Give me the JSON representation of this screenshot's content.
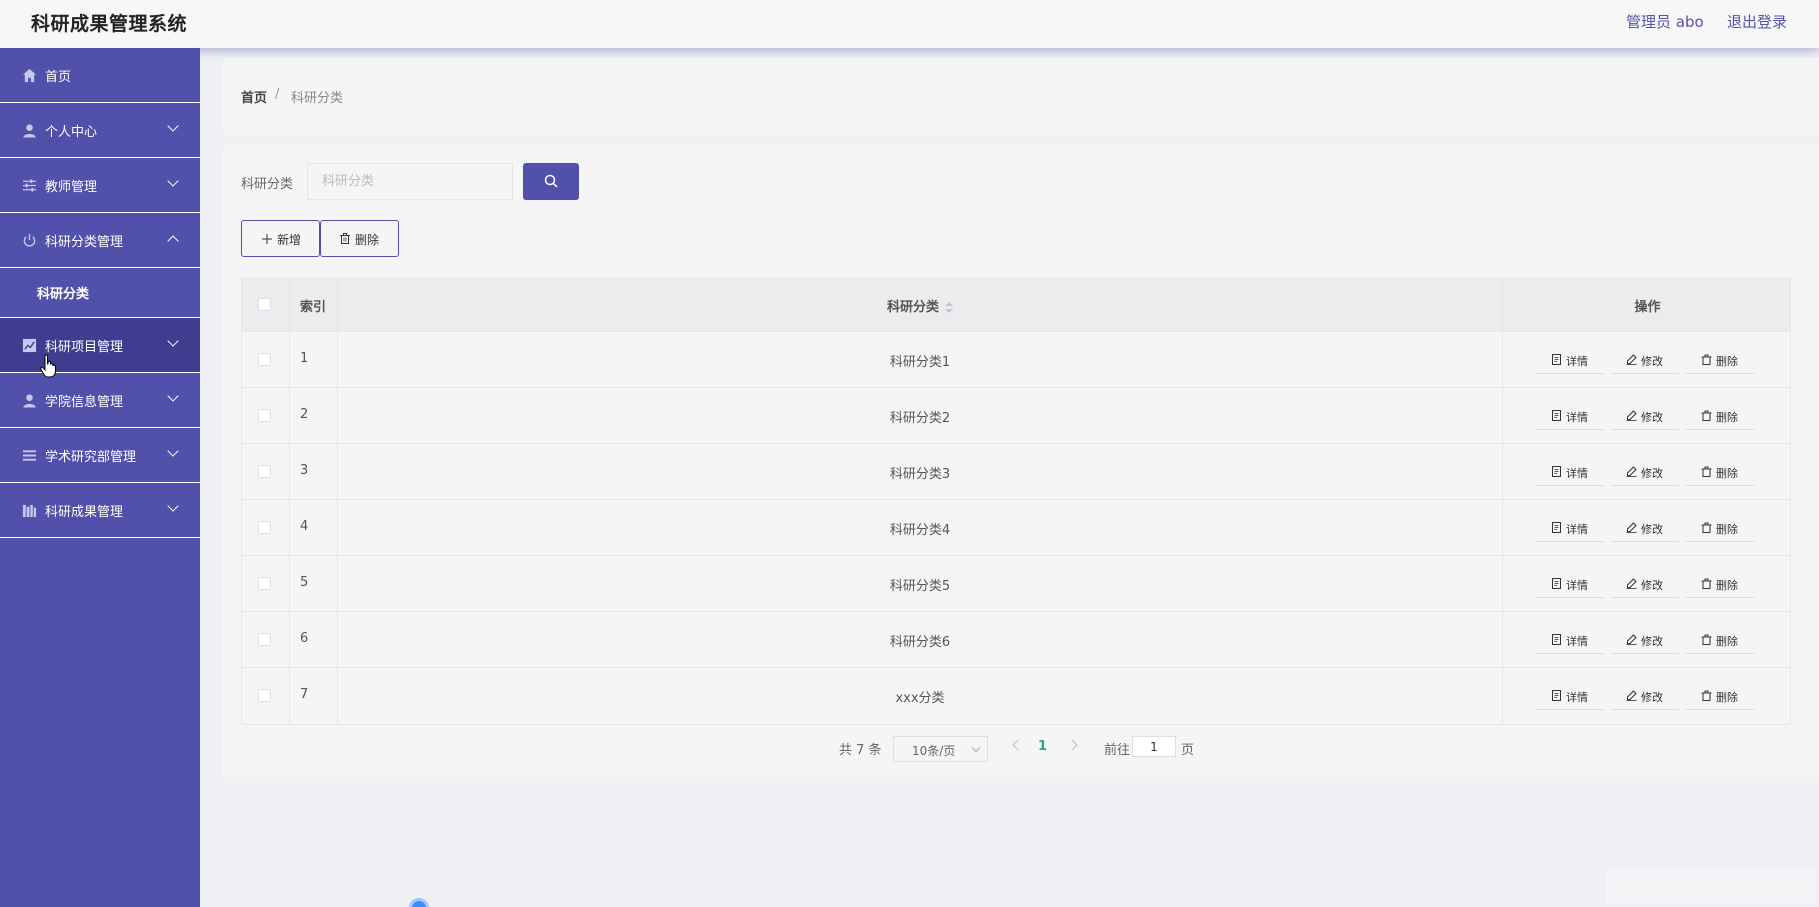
{
  "header": {
    "app_title": "科研成果管理系统",
    "admin_label": "管理员 abo",
    "logout_label": "退出登录"
  },
  "sidebar": {
    "items": [
      {
        "label": "首页",
        "icon": "home-icon"
      },
      {
        "label": "个人中心",
        "icon": "user-icon"
      },
      {
        "label": "教师管理",
        "icon": "sliders-icon"
      },
      {
        "label": "科研分类管理",
        "icon": "power-icon"
      },
      {
        "label": "科研项目管理",
        "icon": "chart-icon"
      },
      {
        "label": "学院信息管理",
        "icon": "user-icon"
      },
      {
        "label": "学术研究部管理",
        "icon": "menu-icon"
      },
      {
        "label": "科研成果管理",
        "icon": "library-icon"
      }
    ],
    "sub_items": [
      {
        "label": "科研分类"
      }
    ]
  },
  "breadcrumb": {
    "home": "首页",
    "separator": "/",
    "current": "科研分类"
  },
  "search": {
    "label": "科研分类",
    "placeholder": "科研分类",
    "value": ""
  },
  "actions": {
    "add_label": "新增",
    "delete_label": "删除"
  },
  "table": {
    "headers": {
      "index": "索引",
      "name": "科研分类",
      "ops": "操作"
    },
    "row_buttons": {
      "detail": "详情",
      "edit": "修改",
      "delete": "删除"
    },
    "rows": [
      {
        "index": "1",
        "name": "科研分类1"
      },
      {
        "index": "2",
        "name": "科研分类2"
      },
      {
        "index": "3",
        "name": "科研分类3"
      },
      {
        "index": "4",
        "name": "科研分类4"
      },
      {
        "index": "5",
        "name": "科研分类5"
      },
      {
        "index": "6",
        "name": "科研分类6"
      },
      {
        "index": "7",
        "name": "xxx分类"
      }
    ]
  },
  "pagination": {
    "total": "共 7 条",
    "page_size": "10条/页",
    "current_page": "1",
    "goto_label": "前往",
    "goto_value": "1",
    "page_suffix": "页"
  },
  "colors": {
    "sidebar_bg": "#5150aa",
    "accent": "#5150aa",
    "active_page": "#2aa57c"
  }
}
